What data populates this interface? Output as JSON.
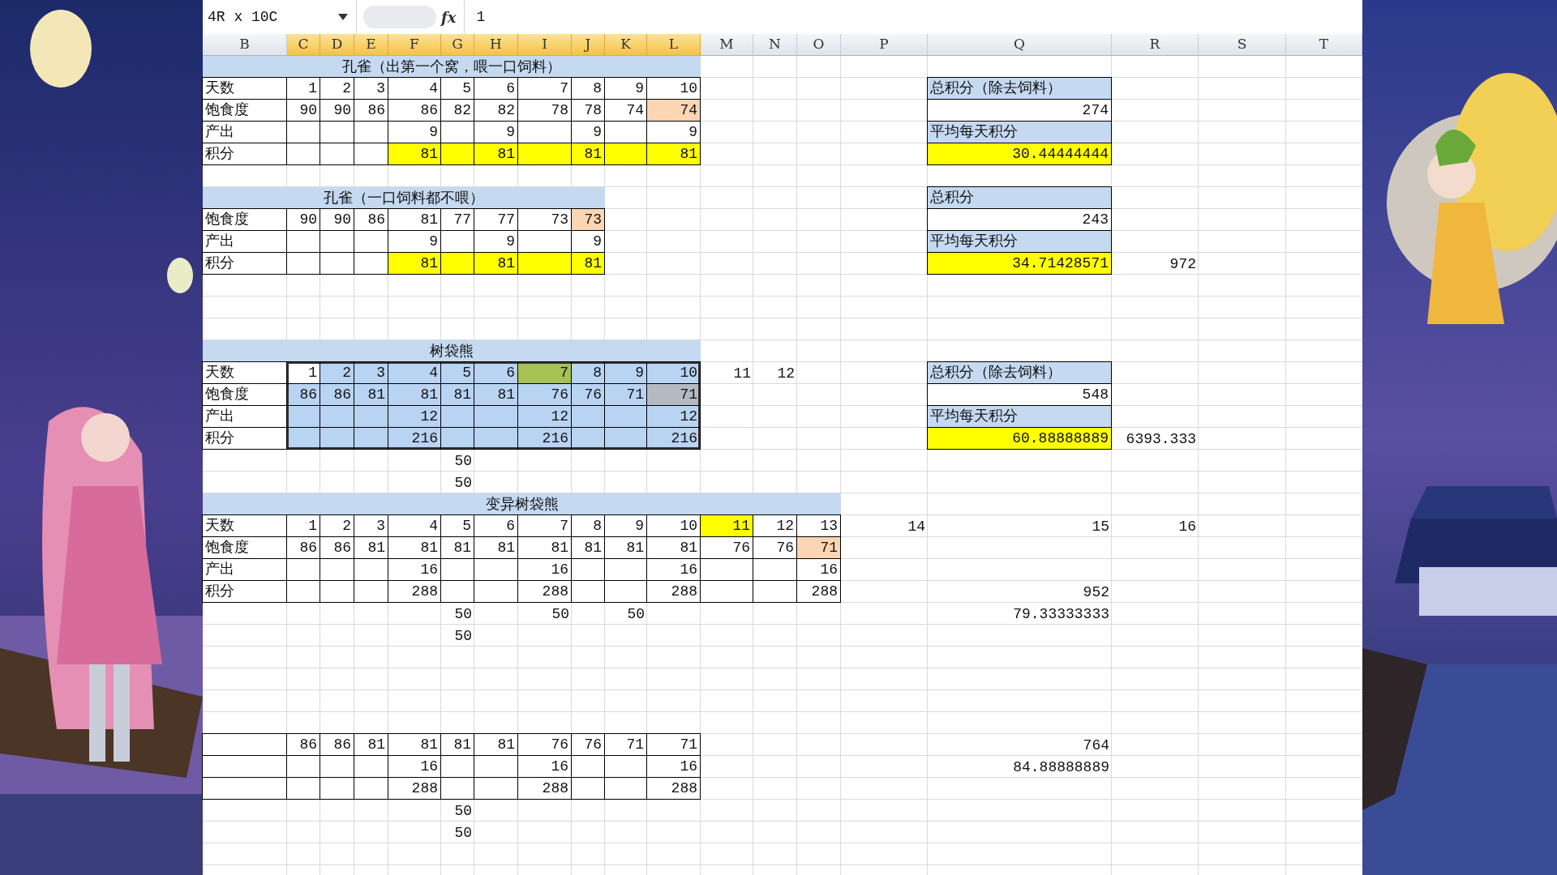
{
  "formula_bar": {
    "name_box": "4R x 10C",
    "function_label": "fx",
    "value": "1"
  },
  "columns": [
    {
      "label": "B",
      "selected": false
    },
    {
      "label": "C",
      "selected": true
    },
    {
      "label": "D",
      "selected": true
    },
    {
      "label": "E",
      "selected": true
    },
    {
      "label": "F",
      "selected": true
    },
    {
      "label": "G",
      "selected": true
    },
    {
      "label": "H",
      "selected": true
    },
    {
      "label": "I",
      "selected": true
    },
    {
      "label": "J",
      "selected": true
    },
    {
      "label": "K",
      "selected": true
    },
    {
      "label": "L",
      "selected": true
    },
    {
      "label": "M",
      "selected": false
    },
    {
      "label": "N",
      "selected": false
    },
    {
      "label": "O",
      "selected": false
    },
    {
      "label": "P",
      "selected": false
    },
    {
      "label": "Q",
      "selected": false
    },
    {
      "label": "R",
      "selected": false
    },
    {
      "label": "S",
      "selected": false
    },
    {
      "label": "T",
      "selected": false
    }
  ],
  "rows": [
    {
      "cells": [
        {
          "kind": "title",
          "text": "孔雀（出第一个窝，喂一口饲料）",
          "color": "#c5d9f1"
        },
        {
          "kind": "merged"
        },
        {
          "kind": "merged"
        },
        {
          "kind": "merged"
        },
        {
          "kind": "merged"
        },
        {
          "kind": "merged"
        },
        {
          "kind": "merged"
        },
        {
          "kind": "merged"
        },
        {
          "kind": "merged"
        },
        {
          "kind": "merged"
        },
        {
          "kind": "merged"
        }
      ]
    },
    {
      "cells": [
        {
          "kind": "label",
          "text": "天数",
          "bordered": true
        },
        {
          "kind": "number",
          "text": "1",
          "bordered": true
        },
        {
          "kind": "number",
          "text": "2",
          "bordered": true
        },
        {
          "kind": "number",
          "text": "3",
          "bordered": true
        },
        {
          "kind": "number",
          "text": "4",
          "bordered": true
        },
        {
          "kind": "number",
          "text": "5",
          "bordered": true
        },
        {
          "kind": "number",
          "text": "6",
          "bordered": true
        },
        {
          "kind": "number",
          "text": "7",
          "bordered": true
        },
        {
          "kind": "number",
          "text": "8",
          "bordered": true
        },
        {
          "kind": "number",
          "text": "9",
          "bordered": true
        },
        {
          "kind": "number",
          "text": "10",
          "bordered": true
        },
        {},
        {},
        {},
        {},
        {
          "kind": "label",
          "text": "总积分（除去饲料）",
          "color": "#c5d9f1",
          "bordered": true
        }
      ]
    },
    {
      "cells": [
        {
          "kind": "label",
          "text": "饱食度",
          "bordered": true
        },
        {
          "kind": "number",
          "text": "90",
          "bordered": true
        },
        {
          "kind": "number",
          "text": "90",
          "bordered": true
        },
        {
          "kind": "number",
          "text": "86",
          "bordered": true
        },
        {
          "kind": "number",
          "text": "86",
          "bordered": true
        },
        {
          "kind": "number",
          "text": "82",
          "bordered": true
        },
        {
          "kind": "number",
          "text": "82",
          "bordered": true
        },
        {
          "kind": "number",
          "text": "78",
          "bordered": true
        },
        {
          "kind": "number",
          "text": "78",
          "bordered": true
        },
        {
          "kind": "number",
          "text": "74",
          "bordered": true
        },
        {
          "kind": "number",
          "text": "74",
          "bordered": true,
          "color": "#fcd5b4"
        },
        {},
        {},
        {},
        {},
        {
          "kind": "number",
          "text": "274",
          "bordered": true
        }
      ]
    },
    {
      "cells": [
        {
          "kind": "label",
          "text": "产出",
          "bordered": true
        },
        {
          "bordered": true
        },
        {
          "bordered": true
        },
        {
          "bordered": true
        },
        {
          "kind": "number",
          "text": "9",
          "bordered": true
        },
        {
          "bordered": true
        },
        {
          "kind": "number",
          "text": "9",
          "bordered": true
        },
        {
          "bordered": true
        },
        {
          "kind": "number",
          "text": "9",
          "bordered": true
        },
        {
          "bordered": true
        },
        {
          "kind": "number",
          "text": "9",
          "bordered": true
        },
        {},
        {},
        {},
        {},
        {
          "kind": "label",
          "text": "平均每天积分",
          "color": "#c5d9f1",
          "bordered": true
        }
      ]
    },
    {
      "cells": [
        {
          "kind": "label",
          "text": "积分",
          "bordered": true
        },
        {
          "bordered": true
        },
        {
          "bordered": true
        },
        {
          "bordered": true
        },
        {
          "kind": "number",
          "text": "81",
          "bordered": true,
          "color": "#ffff00"
        },
        {
          "bordered": true,
          "color": "#ffff00"
        },
        {
          "kind": "number",
          "text": "81",
          "bordered": true,
          "color": "#ffff00"
        },
        {
          "bordered": true,
          "color": "#ffff00"
        },
        {
          "kind": "number",
          "text": "81",
          "bordered": true,
          "color": "#ffff00"
        },
        {
          "bordered": true,
          "color": "#ffff00"
        },
        {
          "kind": "number",
          "text": "81",
          "bordered": true,
          "color": "#ffff00"
        },
        {},
        {},
        {},
        {},
        {
          "kind": "number",
          "text": "30.44444444",
          "bordered": true,
          "color": "#ffff00"
        }
      ]
    },
    {},
    {
      "cells": [
        {
          "kind": "title",
          "text": "孔雀（一口饲料都不喂）",
          "color": "#c5d9f1"
        },
        {
          "kind": "merged"
        },
        {
          "kind": "merged"
        },
        {
          "kind": "merged"
        },
        {
          "kind": "merged"
        },
        {
          "kind": "merged"
        },
        {
          "kind": "merged"
        },
        {
          "kind": "merged"
        },
        {
          "kind": "merged"
        },
        {},
        {},
        {},
        {},
        {},
        {},
        {
          "kind": "label",
          "text": "总积分",
          "color": "#c5d9f1",
          "bordered": true
        }
      ]
    },
    {
      "cells": [
        {
          "kind": "label",
          "text": "饱食度",
          "bordered": true
        },
        {
          "kind": "number",
          "text": "90",
          "bordered": true
        },
        {
          "kind": "number",
          "text": "90",
          "bordered": true
        },
        {
          "kind": "number",
          "text": "86",
          "bordered": true
        },
        {
          "kind": "number",
          "text": "81",
          "bordered": true
        },
        {
          "kind": "number",
          "text": "77",
          "bordered": true
        },
        {
          "kind": "number",
          "text": "77",
          "bordered": true
        },
        {
          "kind": "number",
          "text": "73",
          "bordered": true
        },
        {
          "kind": "number",
          "text": "73",
          "bordered": true,
          "color": "#fcd5b4"
        },
        {},
        {},
        {},
        {},
        {},
        {},
        {
          "kind": "number",
          "text": "243",
          "bordered": true
        }
      ]
    },
    {
      "cells": [
        {
          "kind": "label",
          "text": "产出",
          "bordered": true
        },
        {
          "bordered": true
        },
        {
          "bordered": true
        },
        {
          "bordered": true
        },
        {
          "kind": "number",
          "text": "9",
          "bordered": true
        },
        {
          "bordered": true
        },
        {
          "kind": "number",
          "text": "9",
          "bordered": true
        },
        {
          "bordered": true
        },
        {
          "kind": "number",
          "text": "9",
          "bordered": true
        },
        {},
        {},
        {},
        {},
        {},
        {},
        {
          "kind": "label",
          "text": "平均每天积分",
          "color": "#c5d9f1",
          "bordered": true
        }
      ]
    },
    {
      "cells": [
        {
          "kind": "label",
          "text": "积分",
          "bordered": true
        },
        {
          "bordered": true
        },
        {
          "bordered": true
        },
        {
          "bordered": true
        },
        {
          "kind": "number",
          "text": "81",
          "bordered": true,
          "color": "#ffff00"
        },
        {
          "bordered": true,
          "color": "#ffff00"
        },
        {
          "kind": "number",
          "text": "81",
          "bordered": true,
          "color": "#ffff00"
        },
        {
          "bordered": true,
          "color": "#ffff00"
        },
        {
          "kind": "number",
          "text": "81",
          "bordered": true,
          "color": "#ffff00"
        },
        {},
        {},
        {},
        {},
        {},
        {},
        {
          "kind": "number",
          "text": "34.71428571",
          "bordered": true,
          "color": "#ffff00"
        },
        {
          "kind": "number",
          "text": "972"
        }
      ]
    },
    {},
    {},
    {},
    {
      "cells": [
        {
          "kind": "title",
          "text": "树袋熊",
          "color": "#c5d9f1"
        },
        {
          "kind": "merged"
        },
        {
          "kind": "merged"
        },
        {
          "kind": "merged"
        },
        {
          "kind": "merged"
        },
        {
          "kind": "merged"
        },
        {
          "kind": "merged"
        },
        {
          "kind": "merged"
        },
        {
          "kind": "merged"
        },
        {
          "kind": "merged"
        },
        {
          "kind": "merged"
        }
      ]
    },
    {
      "cells": [
        {
          "kind": "label",
          "text": "天数",
          "bordered": true
        },
        {
          "kind": "number",
          "text": "1",
          "bordered": true,
          "selected": true,
          "active": true
        },
        {
          "kind": "number",
          "text": "2",
          "bordered": true,
          "selected": true
        },
        {
          "kind": "number",
          "text": "3",
          "bordered": true,
          "selected": true
        },
        {
          "kind": "number",
          "text": "4",
          "bordered": true,
          "selected": true
        },
        {
          "kind": "number",
          "text": "5",
          "bordered": true,
          "selected": true
        },
        {
          "kind": "number",
          "text": "6",
          "bordered": true,
          "selected": true
        },
        {
          "kind": "number",
          "text": "7",
          "bordered": true,
          "selected": true,
          "color": "#a5c255"
        },
        {
          "kind": "number",
          "text": "8",
          "bordered": true,
          "selected": true
        },
        {
          "kind": "number",
          "text": "9",
          "bordered": true,
          "selected": true
        },
        {
          "kind": "number",
          "text": "10",
          "bordered": true,
          "selected": true
        },
        {
          "kind": "number",
          "text": "11"
        },
        {
          "kind": "number",
          "text": "12"
        },
        {},
        {},
        {
          "kind": "label",
          "text": "总积分（除去饲料）",
          "color": "#c5d9f1",
          "bordered": true
        }
      ]
    },
    {
      "cells": [
        {
          "kind": "label",
          "text": "饱食度",
          "bordered": true
        },
        {
          "kind": "number",
          "text": "86",
          "bordered": true,
          "selected": true
        },
        {
          "kind": "number",
          "text": "86",
          "bordered": true,
          "selected": true
        },
        {
          "kind": "number",
          "text": "81",
          "bordered": true,
          "selected": true
        },
        {
          "kind": "number",
          "text": "81",
          "bordered": true,
          "selected": true
        },
        {
          "kind": "number",
          "text": "81",
          "bordered": true,
          "selected": true
        },
        {
          "kind": "number",
          "text": "81",
          "bordered": true,
          "selected": true
        },
        {
          "kind": "number",
          "text": "76",
          "bordered": true,
          "selected": true
        },
        {
          "kind": "number",
          "text": "76",
          "bordered": true,
          "selected": true
        },
        {
          "kind": "number",
          "text": "71",
          "bordered": true,
          "selected": true
        },
        {
          "kind": "number",
          "text": "71",
          "bordered": true,
          "selected": true,
          "color": "#b4bac4"
        },
        {},
        {},
        {},
        {},
        {
          "kind": "number",
          "text": "548",
          "bordered": true
        }
      ]
    },
    {
      "cells": [
        {
          "kind": "label",
          "text": "产出",
          "bordered": true
        },
        {
          "bordered": true,
          "selected": true
        },
        {
          "bordered": true,
          "selected": true
        },
        {
          "bordered": true,
          "selected": true
        },
        {
          "kind": "number",
          "text": "12",
          "bordered": true,
          "selected": true
        },
        {
          "bordered": true,
          "selected": true
        },
        {
          "bordered": true,
          "selected": true
        },
        {
          "kind": "number",
          "text": "12",
          "bordered": true,
          "selected": true
        },
        {
          "bordered": true,
          "selected": true
        },
        {
          "bordered": true,
          "selected": true
        },
        {
          "kind": "number",
          "text": "12",
          "bordered": true,
          "selected": true
        },
        {},
        {},
        {},
        {},
        {
          "kind": "label",
          "text": "平均每天积分",
          "color": "#c5d9f1",
          "bordered": true
        }
      ]
    },
    {
      "cells": [
        {
          "kind": "label",
          "text": "积分",
          "bordered": true
        },
        {
          "bordered": true,
          "selected": true
        },
        {
          "bordered": true,
          "selected": true
        },
        {
          "bordered": true,
          "selected": true
        },
        {
          "kind": "number",
          "text": "216",
          "bordered": true,
          "selected": true
        },
        {
          "bordered": true,
          "selected": true
        },
        {
          "bordered": true,
          "selected": true
        },
        {
          "kind": "number",
          "text": "216",
          "bordered": true,
          "selected": true
        },
        {
          "bordered": true,
          "selected": true
        },
        {
          "bordered": true,
          "selected": true
        },
        {
          "kind": "number",
          "text": "216",
          "bordered": true,
          "selected": true
        },
        {},
        {},
        {},
        {},
        {
          "kind": "number",
          "text": "60.88888889",
          "bordered": true,
          "color": "#ffff00"
        },
        {
          "kind": "number",
          "text": "6393.333"
        }
      ]
    },
    {
      "cells": [
        {},
        {},
        {},
        {},
        {},
        {
          "kind": "number",
          "text": "50"
        }
      ]
    },
    {
      "cells": [
        {},
        {},
        {},
        {},
        {},
        {
          "kind": "number",
          "text": "50"
        }
      ]
    },
    {
      "cells": [
        {
          "kind": "title",
          "text": "变异树袋熊",
          "color": "#c5d9f1"
        },
        {
          "kind": "merged"
        },
        {
          "kind": "merged"
        },
        {
          "kind": "merged"
        },
        {
          "kind": "merged"
        },
        {
          "kind": "merged"
        },
        {
          "kind": "merged"
        },
        {
          "kind": "merged"
        },
        {
          "kind": "merged"
        },
        {
          "kind": "merged"
        },
        {
          "kind": "merged"
        },
        {
          "kind": "merged"
        },
        {
          "kind": "merged"
        },
        {
          "kind": "merged"
        }
      ]
    },
    {
      "cells": [
        {
          "kind": "label",
          "text": "天数",
          "bordered": true
        },
        {
          "kind": "number",
          "text": "1",
          "bordered": true
        },
        {
          "kind": "number",
          "text": "2",
          "bordered": true
        },
        {
          "kind": "number",
          "text": "3",
          "bordered": true
        },
        {
          "kind": "number",
          "text": "4",
          "bordered": true
        },
        {
          "kind": "number",
          "text": "5",
          "bordered": true
        },
        {
          "kind": "number",
          "text": "6",
          "bordered": true
        },
        {
          "kind": "number",
          "text": "7",
          "bordered": true
        },
        {
          "kind": "number",
          "text": "8",
          "bordered": true
        },
        {
          "kind": "number",
          "text": "9",
          "bordered": true
        },
        {
          "kind": "number",
          "text": "10",
          "bordered": true
        },
        {
          "kind": "number",
          "text": "11",
          "bordered": true,
          "color": "#ffff00"
        },
        {
          "kind": "number",
          "text": "12",
          "bordered": true
        },
        {
          "kind": "number",
          "text": "13",
          "bordered": true
        },
        {
          "kind": "number",
          "text": "14"
        },
        {
          "kind": "number",
          "text": "15"
        },
        {
          "kind": "number",
          "text": "16"
        }
      ]
    },
    {
      "cells": [
        {
          "kind": "label",
          "text": "饱食度",
          "bordered": true
        },
        {
          "kind": "number",
          "text": "86",
          "bordered": true
        },
        {
          "kind": "number",
          "text": "86",
          "bordered": true
        },
        {
          "kind": "number",
          "text": "81",
          "bordered": true
        },
        {
          "kind": "number",
          "text": "81",
          "bordered": true
        },
        {
          "kind": "number",
          "text": "81",
          "bordered": true
        },
        {
          "kind": "number",
          "text": "81",
          "bordered": true
        },
        {
          "kind": "number",
          "text": "81",
          "bordered": true
        },
        {
          "kind": "number",
          "text": "81",
          "bordered": true
        },
        {
          "kind": "number",
          "text": "81",
          "bordered": true
        },
        {
          "kind": "number",
          "text": "81",
          "bordered": true
        },
        {
          "kind": "number",
          "text": "76",
          "bordered": true
        },
        {
          "kind": "number",
          "text": "76",
          "bordered": true
        },
        {
          "kind": "number",
          "text": "71",
          "bordered": true,
          "color": "#fcd5b4"
        }
      ]
    },
    {
      "cells": [
        {
          "kind": "label",
          "text": "产出",
          "bordered": true
        },
        {
          "bordered": true
        },
        {
          "bordered": true
        },
        {
          "bordered": true
        },
        {
          "kind": "number",
          "text": "16",
          "bordered": true
        },
        {
          "bordered": true
        },
        {
          "bordered": true
        },
        {
          "kind": "number",
          "text": "16",
          "bordered": true
        },
        {
          "bordered": true
        },
        {
          "bordered": true
        },
        {
          "kind": "number",
          "text": "16",
          "bordered": true
        },
        {
          "bordered": true
        },
        {
          "bordered": true
        },
        {
          "kind": "number",
          "text": "16",
          "bordered": true
        }
      ]
    },
    {
      "cells": [
        {
          "kind": "label",
          "text": "积分",
          "bordered": true
        },
        {
          "bordered": true
        },
        {
          "bordered": true
        },
        {
          "bordered": true
        },
        {
          "kind": "number",
          "text": "288",
          "bordered": true
        },
        {
          "bordered": true
        },
        {
          "bordered": true
        },
        {
          "kind": "number",
          "text": "288",
          "bordered": true
        },
        {
          "bordered": true
        },
        {
          "bordered": true
        },
        {
          "kind": "number",
          "text": "288",
          "bordered": true
        },
        {
          "bordered": true
        },
        {
          "bordered": true
        },
        {
          "kind": "number",
          "text": "288",
          "bordered": true
        },
        {},
        {
          "kind": "number",
          "text": "952"
        }
      ]
    },
    {
      "cells": [
        {},
        {},
        {},
        {},
        {},
        {
          "kind": "number",
          "text": "50"
        },
        {},
        {
          "kind": "number",
          "text": "50"
        },
        {},
        {
          "kind": "number",
          "text": "50"
        },
        {},
        {},
        {},
        {},
        {},
        {
          "kind": "number",
          "text": "79.33333333"
        }
      ]
    },
    {
      "cells": [
        {},
        {},
        {},
        {},
        {},
        {
          "kind": "number",
          "text": "50"
        }
      ]
    },
    {},
    {},
    {},
    {},
    {
      "cells": [
        {
          "bordered": true
        },
        {
          "kind": "number",
          "text": "86",
          "bordered": true
        },
        {
          "kind": "number",
          "text": "86",
          "bordered": true
        },
        {
          "kind": "number",
          "text": "81",
          "bordered": true
        },
        {
          "kind": "number",
          "text": "81",
          "bordered": true
        },
        {
          "kind": "number",
          "text": "81",
          "bordered": true
        },
        {
          "kind": "number",
          "text": "81",
          "bordered": true
        },
        {
          "kind": "number",
          "text": "76",
          "bordered": true
        },
        {
          "kind": "number",
          "text": "76",
          "bordered": true
        },
        {
          "kind": "number",
          "text": "71",
          "bordered": true
        },
        {
          "kind": "number",
          "text": "71",
          "bordered": true
        },
        {},
        {},
        {},
        {},
        {
          "kind": "number",
          "text": "764"
        }
      ]
    },
    {
      "cells": [
        {
          "bordered": true
        },
        {
          "bordered": true
        },
        {
          "bordered": true
        },
        {
          "bordered": true
        },
        {
          "kind": "number",
          "text": "16",
          "bordered": true
        },
        {
          "bordered": true
        },
        {
          "bordered": true
        },
        {
          "kind": "number",
          "text": "16",
          "bordered": true
        },
        {
          "bordered": true
        },
        {
          "bordered": true
        },
        {
          "kind": "number",
          "text": "16",
          "bordered": true
        },
        {},
        {},
        {},
        {},
        {
          "kind": "number",
          "text": "84.88888889"
        }
      ]
    },
    {
      "cells": [
        {
          "bordered": true
        },
        {
          "bordered": true
        },
        {
          "bordered": true
        },
        {
          "bordered": true
        },
        {
          "kind": "number",
          "text": "288",
          "bordered": true
        },
        {
          "bordered": true
        },
        {
          "bordered": true
        },
        {
          "kind": "number",
          "text": "288",
          "bordered": true
        },
        {
          "bordered": true
        },
        {
          "bordered": true
        },
        {
          "kind": "number",
          "text": "288",
          "bordered": true
        }
      ]
    },
    {
      "cells": [
        {},
        {},
        {},
        {},
        {},
        {
          "kind": "number",
          "text": "50"
        }
      ]
    },
    {
      "cells": [
        {},
        {},
        {},
        {},
        {},
        {
          "kind": "number",
          "text": "50"
        }
      ]
    },
    {}
  ]
}
